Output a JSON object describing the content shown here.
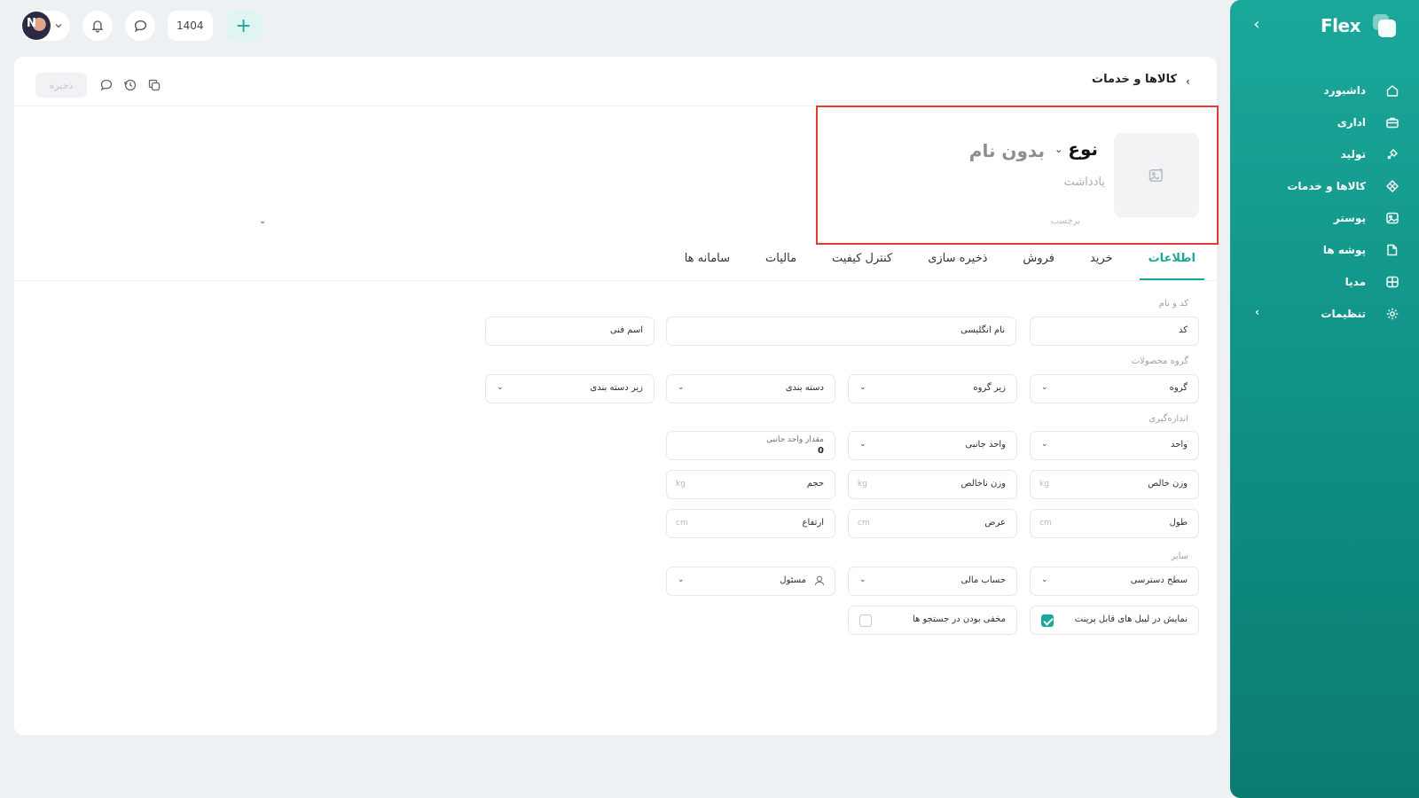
{
  "sidebar": {
    "logo": "Flex",
    "items": [
      {
        "label": "داشبورد",
        "icon": "home-icon"
      },
      {
        "label": "اداری",
        "icon": "briefcase-icon"
      },
      {
        "label": "تولید",
        "icon": "tools-icon"
      },
      {
        "label": "کالاها و خدمات",
        "icon": "diamond-icon"
      },
      {
        "label": "پوستر",
        "icon": "image-icon"
      },
      {
        "label": "پوشه ها",
        "icon": "folder-icon"
      },
      {
        "label": "مدیا",
        "icon": "globe-icon"
      },
      {
        "label": "تنظیمات",
        "icon": "gear-icon"
      }
    ]
  },
  "topbar": {
    "year": "1404"
  },
  "header": {
    "save_label": "ذخیره",
    "breadcrumb": "کالاها و خدمات",
    "type_label": "نوع",
    "name_placeholder": "بدون نام",
    "note_placeholder": "یادداشت",
    "tag_label": "برچسب"
  },
  "tabs": [
    "اطلاعات",
    "خرید",
    "فروش",
    "ذخیره سازی",
    "کنترل کیفیت",
    "مالیات",
    "سامانه ها"
  ],
  "form": {
    "sections": {
      "code_name": "کد و نام",
      "product_group": "گروه محصولات",
      "measurement": "اندازه‌گیری",
      "other": "سایر"
    },
    "code": "کد",
    "english_name": "نام انگلیسی",
    "technical_name": "اسم فنی",
    "group": "گروه",
    "subgroup": "زیر گروه",
    "category": "دسته بندی",
    "subcategory": "زیر دسته بندی",
    "unit": "واحد",
    "secondary_unit": "واحد جانبی",
    "secondary_unit_amount_label": "مقدار واحد جانبی",
    "secondary_unit_amount_value": "0",
    "net_weight": "وزن خالص",
    "gross_weight": "وزن ناخالص",
    "volume": "حجم",
    "length": "طول",
    "width": "عرض",
    "height": "ارتفاع",
    "weight_unit": "kg",
    "length_unit": "cm",
    "access_level": "سطح دسترسی",
    "financial_account": "حساب مالی",
    "responsible": "مسئول",
    "show_in_labels": "نمایش در لیبل های قابل پرینت",
    "show_in_labels_checked": true,
    "hidden_in_search": "مخفی بودن در جستجو ها",
    "hidden_in_search_checked": false
  }
}
